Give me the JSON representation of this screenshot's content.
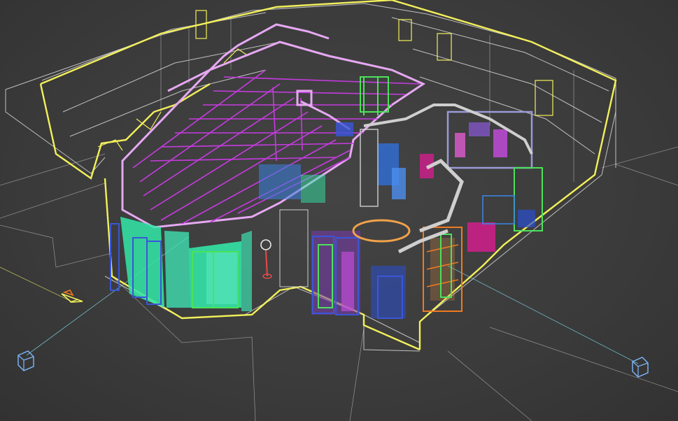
{
  "viewport": {
    "mode": "wireframe",
    "background": "#3a3a3a",
    "wire_color": "#d9d9d9",
    "selection_color": "#f2f05a"
  },
  "objects": {
    "outer_walls": "#f2f05a",
    "roof_beams": "#c63be0",
    "window_glass": "#33e8a8",
    "window_frames": "#3a56d8",
    "fixtures_green": "#4be25a",
    "accents_orange": "#f07a1e",
    "furniture_magenta": "#d21e8c",
    "furniture_blue": "#3b82e0"
  },
  "gizmos": {
    "camera_icon": "camera-icon",
    "camera_target_left": "camera-target-icon",
    "camera_target_right": "camera-target-icon"
  }
}
